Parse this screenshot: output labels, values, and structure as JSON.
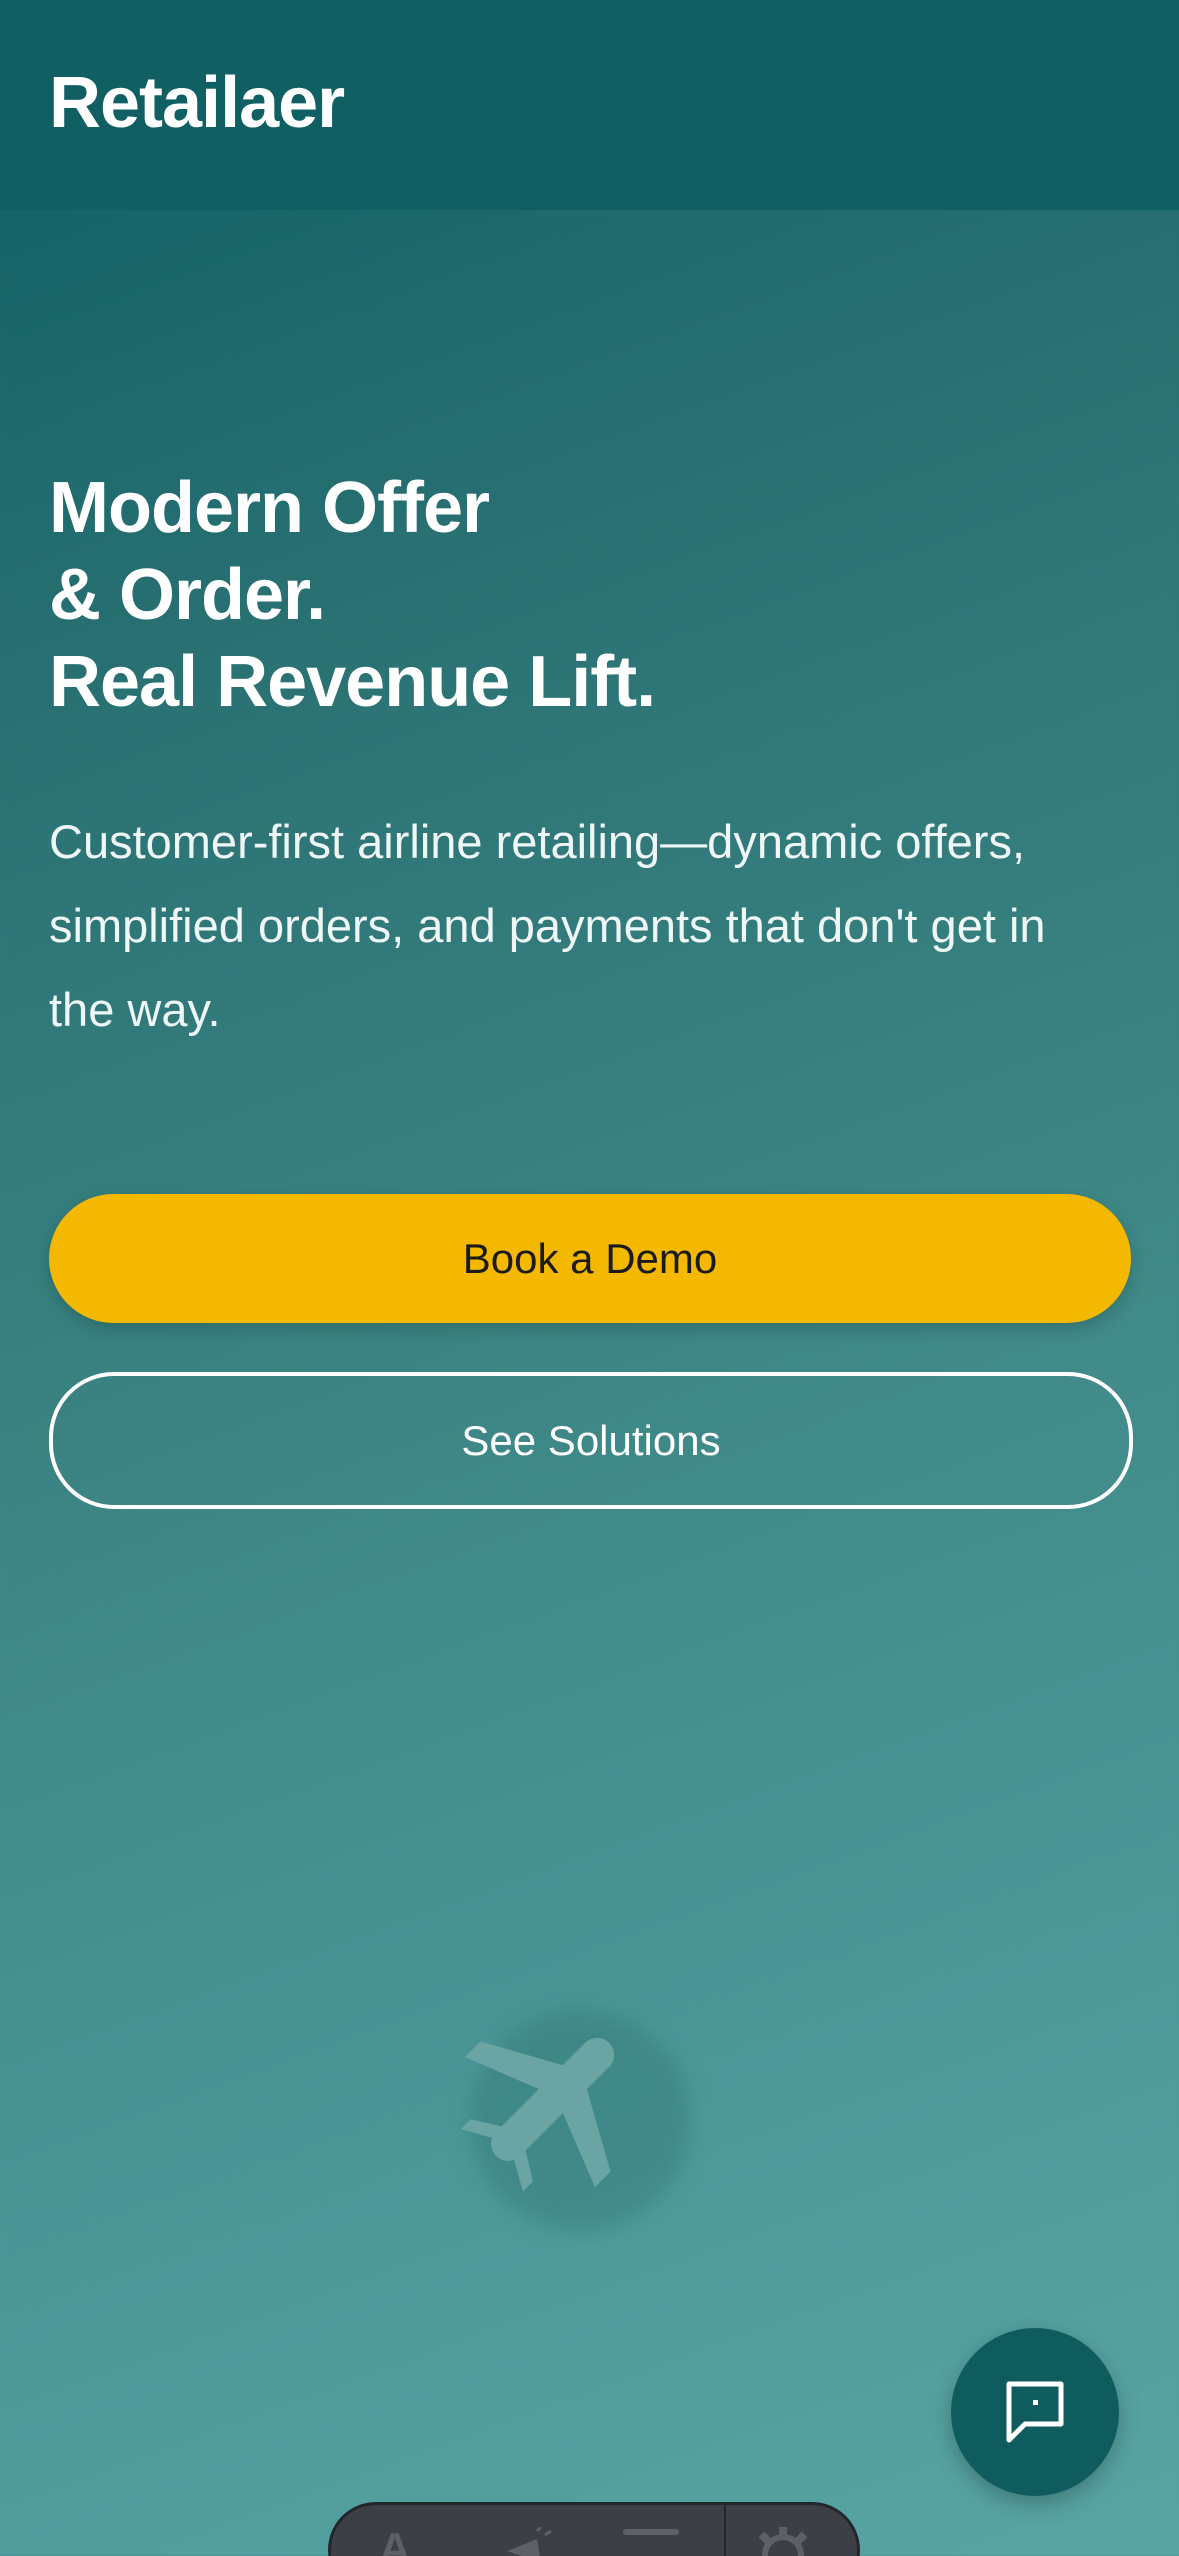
{
  "header": {
    "brand": "Retailaer"
  },
  "hero": {
    "title_lines": [
      "Modern Offer",
      "& Order.",
      "Real Revenue Lift."
    ],
    "subtitle": "Customer-first airline retailing—dynamic offers, simplified orders, and payments that don't get in the way.",
    "primary_button": "Book a Demo",
    "secondary_button": "See Solutions",
    "illustration_icon": "airplane-icon"
  },
  "chat": {
    "icon": "chat-bubble-icon"
  },
  "dock": {
    "items": [
      "text-format-icon",
      "megaphone-icon",
      "minus-icon",
      "gear-icon"
    ]
  },
  "colors": {
    "header_bg": "#0f5f63",
    "accent_yellow": "#f4b800",
    "chat_button": "#0f5c5f",
    "text_white": "#ffffff"
  }
}
